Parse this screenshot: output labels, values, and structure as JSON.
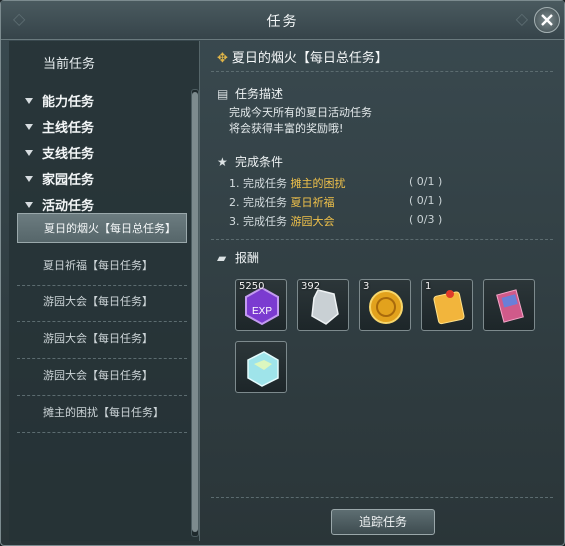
{
  "window": {
    "title": "任务"
  },
  "left": {
    "header": "当前任务",
    "categories": [
      "能力任务",
      "主线任务",
      "支线任务",
      "家园任务",
      "活动任务"
    ],
    "quests": [
      {
        "label": "夏日的烟火【每日总任务】",
        "selected": true
      },
      {
        "label": "夏日祈福【每日任务】",
        "selected": false
      },
      {
        "label": "游园大会【每日任务】",
        "selected": false
      },
      {
        "label": "游园大会【每日任务】",
        "selected": false
      },
      {
        "label": "游园大会【每日任务】",
        "selected": false
      },
      {
        "label": "摊主的困扰【每日任务】",
        "selected": false
      }
    ]
  },
  "detail": {
    "title": "夏日的烟火【每日总任务】",
    "desc_header": "任务描述",
    "desc_lines": [
      "完成今天所有的夏日活动任务",
      "将会获得丰富的奖励哦!"
    ],
    "cond_header": "完成条件",
    "conditions": [
      {
        "index": "1.",
        "prefix": "完成任务",
        "name": "摊主的困扰",
        "progress": "( 0/1 )"
      },
      {
        "index": "2.",
        "prefix": "完成任务",
        "name": "夏日祈福",
        "progress": "( 0/1 )"
      },
      {
        "index": "3.",
        "prefix": "完成任务",
        "name": "游园大会",
        "progress": "( 0/3 )"
      }
    ],
    "reward_header": "报酬",
    "rewards": [
      {
        "icon": "exp-icon",
        "count": "5250"
      },
      {
        "icon": "crystal-icon",
        "count": "392"
      },
      {
        "icon": "gold-coin-icon",
        "count": "3"
      },
      {
        "icon": "red-packet-icon",
        "count": "1"
      },
      {
        "icon": "card-pack-icon",
        "count": ""
      },
      {
        "icon": "ice-cube-icon",
        "count": ""
      }
    ],
    "track_button": "追踪任务"
  },
  "colors": {
    "highlight": "#f1c24a",
    "background": "#2a3538"
  }
}
